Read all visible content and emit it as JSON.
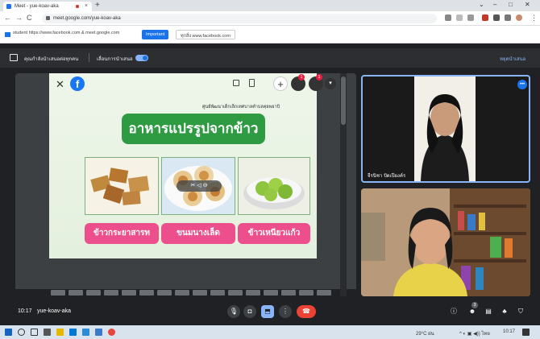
{
  "browser": {
    "tab_title": "Meet - yue-koav-aka",
    "url": "meet.google.com/yue-koav-aka",
    "new_tab": "+",
    "window_controls": [
      "⌄",
      "–",
      "□",
      "✕"
    ]
  },
  "bookmarks": {
    "item1": "student https://www.facebook.com & meet.google.com",
    "button1": "Important",
    "button2": "ทุกสิ่ง www.facebook.com"
  },
  "meet_topbar": {
    "presenting_label": "คุณกำลังนำเสนอต่อทุกคน",
    "toggle_label": "เลื่อนการนำเสนอ",
    "stop_label": "หยุดนำเสนอ"
  },
  "slide": {
    "school_caption": "ศูนย์พัฒนาเด็กเล็กเทศบาลตำบลคุยพยาบิ",
    "title": "อาหารแปรรูปจากข้าว",
    "labels": [
      "ข้าวกระยาสารท",
      "ขนมนางเล็ด",
      "ข้าวเหนียวแก้ว"
    ]
  },
  "participants": [
    {
      "name": "จีรนิชา ปัดเปียงค์ร"
    },
    {
      "name": ""
    }
  ],
  "bottom": {
    "time": "10:17",
    "meeting_code": "yue-koav-aka",
    "participant_badge": "3"
  },
  "taskbar": {
    "weather": "29°C ฝน",
    "time": "10:17"
  },
  "colors": {
    "slide_green": "#2e9a42",
    "label_pink": "#ec4f8c",
    "end_call_red": "#ea4335",
    "accent_blue": "#8ab4f8"
  }
}
